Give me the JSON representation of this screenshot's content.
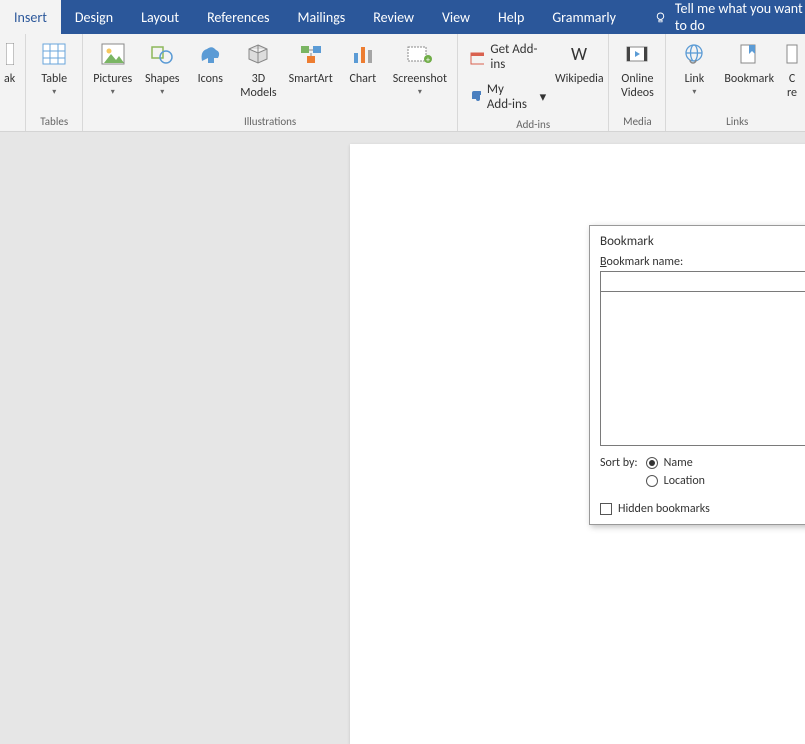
{
  "tabs": {
    "insert": "Insert",
    "design": "Design",
    "layout": "Layout",
    "references": "References",
    "mailings": "Mailings",
    "review": "Review",
    "view": "View",
    "help": "Help",
    "grammarly": "Grammarly"
  },
  "tell_me": "Tell me what you want to do",
  "ribbon": {
    "tables_group": "Tables",
    "illustrations_group": "Illustrations",
    "addins_group": "Add-ins",
    "media_group": "Media",
    "links_group": "Links",
    "page_break": "ak",
    "table": "Table",
    "pictures": "Pictures",
    "shapes": "Shapes",
    "icons": "Icons",
    "models": "3D\nModels",
    "smartart": "SmartArt",
    "chart": "Chart",
    "screenshot": "Screenshot",
    "get_addins": "Get Add-ins",
    "my_addins": "My Add-ins",
    "wikipedia": "Wikipedia",
    "online_videos": "Online\nVideos",
    "link": "Link",
    "bookmark": "Bookmark",
    "cross_ref": "C\nre"
  },
  "dialog": {
    "title": "Bookmark",
    "name_label_pre": "B",
    "name_label_post": "ookmark name:",
    "name_value": "",
    "sort_by": "Sort by:",
    "sort_name_pre": "N",
    "sort_name_post": "ame",
    "sort_location_pre": "L",
    "sort_location_post": "ocation",
    "hidden_pre": "H",
    "hidden_post": "idden bookmarks"
  }
}
